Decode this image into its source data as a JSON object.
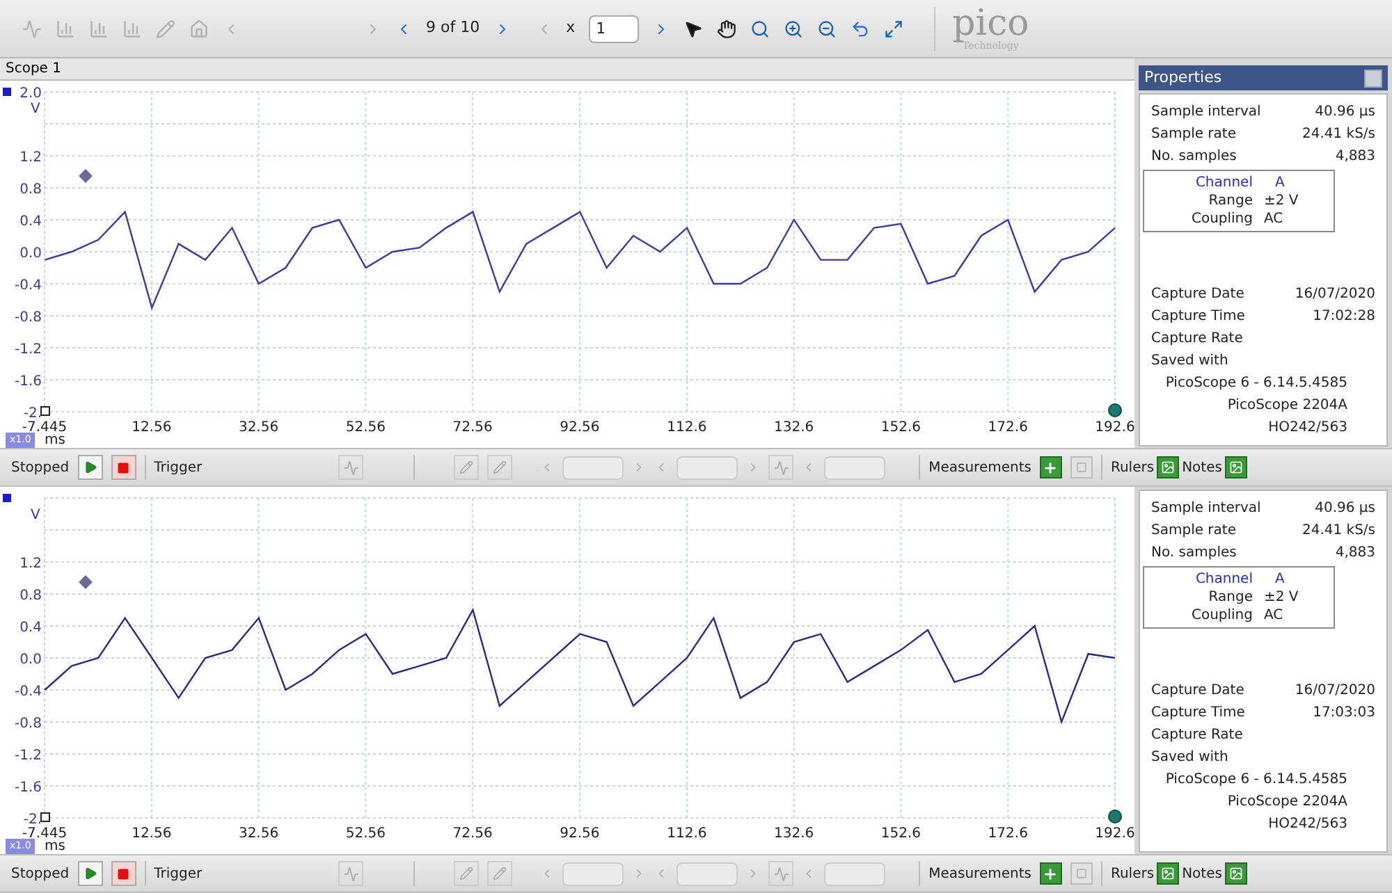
{
  "toolbar": {
    "page": "9 of 10",
    "zoom_prefix": "x",
    "zoom_value": "1",
    "logo": "pico",
    "logo_sub": "Technology"
  },
  "tab": "Scope 1",
  "scopes": [
    {
      "unit": "V",
      "time_unit": "ms",
      "zoom_badge": "x1.0",
      "chart_data": {
        "type": "line",
        "xlim": [
          -7.445,
          192.6
        ],
        "ylim": [
          -2,
          2
        ],
        "xticks": [
          {
            "value": -7.445,
            "label": "-7.445"
          },
          {
            "value": 12.56,
            "label": "12.56"
          },
          {
            "value": 32.56,
            "label": "32.56"
          },
          {
            "value": 52.56,
            "label": "52.56"
          },
          {
            "value": 72.56,
            "label": "72.56"
          },
          {
            "value": 92.56,
            "label": "92.56"
          },
          {
            "value": 112.6,
            "label": "112.6"
          },
          {
            "value": 132.6,
            "label": "132.6"
          },
          {
            "value": 152.6,
            "label": "152.6"
          },
          {
            "value": 172.6,
            "label": "172.6"
          },
          {
            "value": 192.6,
            "label": "192.6"
          }
        ],
        "yticks": [
          {
            "value": 2,
            "label": "2.0"
          },
          {
            "value": 1.2,
            "label": "1.2"
          },
          {
            "value": 0.8,
            "label": "0.8"
          },
          {
            "value": 0.4,
            "label": "0.4"
          },
          {
            "value": 0,
            "label": "0.0"
          },
          {
            "value": -0.4,
            "label": "-0.4"
          },
          {
            "value": -0.8,
            "label": "-0.8"
          },
          {
            "value": -1.2,
            "label": "-1.2"
          },
          {
            "value": -1.6,
            "label": "-1.6"
          },
          {
            "value": -2,
            "label": "-2."
          }
        ],
        "x": [
          -7.4,
          -2.4,
          2.6,
          7.6,
          12.6,
          17.6,
          22.6,
          27.6,
          32.6,
          37.6,
          42.6,
          47.6,
          52.6,
          57.6,
          62.6,
          67.6,
          72.6,
          77.6,
          82.6,
          87.6,
          92.6,
          97.6,
          102.6,
          107.6,
          112.6,
          117.6,
          122.6,
          127.6,
          132.6,
          137.6,
          142.6,
          147.6,
          152.6,
          157.6,
          162.6,
          167.6,
          172.6,
          177.6,
          182.6,
          187.6,
          192.6
        ],
        "grid": true,
        "series": [
          {
            "color": "#3b3b9e",
            "values": [
              -0.1,
              0.0,
              0.15,
              0.5,
              -0.7,
              0.1,
              -0.1,
              0.3,
              -0.4,
              -0.2,
              0.3,
              0.4,
              -0.2,
              0.0,
              0.05,
              0.3,
              0.5,
              -0.5,
              0.1,
              0.3,
              0.5,
              -0.2,
              0.2,
              0.0,
              0.3,
              -0.4,
              -0.4,
              -0.2,
              0.4,
              -0.1,
              -0.1,
              0.3,
              0.35,
              -0.4,
              -0.3,
              0.2,
              0.4,
              -0.5,
              -0.1,
              0.0,
              0.3
            ]
          }
        ]
      },
      "properties": {
        "header": "Properties",
        "rows": [
          {
            "label": "Sample interval",
            "value": "40.96 µs"
          },
          {
            "label": "Sample rate",
            "value": "24.41 kS/s"
          },
          {
            "label": "No. samples",
            "value": "4,883"
          }
        ],
        "channel": {
          "label": "Channel",
          "value": "A"
        },
        "channel_rows": [
          {
            "label": "Range",
            "value": "±2 V"
          },
          {
            "label": "Coupling",
            "value": "AC"
          }
        ],
        "capture": [
          {
            "label": "Capture Date",
            "value": "16/07/2020"
          },
          {
            "label": "Capture Time",
            "value": "17:02:28"
          },
          {
            "label": "Capture Rate"
          },
          {
            "label": "Saved with"
          }
        ],
        "saved_with": [
          "PicoScope 6 - 6.14.5.4585",
          "PicoScope 2204A",
          "HO242/563"
        ]
      },
      "controls": {
        "status": "Stopped",
        "running": false,
        "trigger": "Trigger",
        "measurements": "Measurements",
        "rulers": "Rulers",
        "notes": "Notes"
      }
    },
    {
      "unit": "V",
      "time_unit": "ms",
      "zoom_badge": "x1.0",
      "chart_data": {
        "type": "line",
        "xlim": [
          -7.445,
          192.6
        ],
        "ylim": [
          -2,
          2
        ],
        "xticks": [
          {
            "value": -7.445,
            "label": "-7.445"
          },
          {
            "value": 12.56,
            "label": "12.56"
          },
          {
            "value": 32.56,
            "label": "32.56"
          },
          {
            "value": 52.56,
            "label": "52.56"
          },
          {
            "value": 72.56,
            "label": "72.56"
          },
          {
            "value": 92.56,
            "label": "92.56"
          },
          {
            "value": 112.6,
            "label": "112.6"
          },
          {
            "value": 132.6,
            "label": "132.6"
          },
          {
            "value": 152.6,
            "label": "152.6"
          },
          {
            "value": 172.6,
            "label": "172.6"
          },
          {
            "value": 192.6,
            "label": "192.6"
          }
        ],
        "yticks": [
          {
            "value": 1.2,
            "label": "1.2"
          },
          {
            "value": 0.8,
            "label": "0.8"
          },
          {
            "value": 0.4,
            "label": "0.4"
          },
          {
            "value": 0,
            "label": "0.0"
          },
          {
            "value": -0.4,
            "label": "-0.4"
          },
          {
            "value": -0.8,
            "label": "-0.8"
          },
          {
            "value": -1.2,
            "label": "-1.2"
          },
          {
            "value": -1.6,
            "label": "-1.6"
          },
          {
            "value": -2,
            "label": "-2."
          }
        ],
        "x": [
          -7.4,
          -2.4,
          2.6,
          7.6,
          12.6,
          17.6,
          22.6,
          27.6,
          32.6,
          37.6,
          42.6,
          47.6,
          52.6,
          57.6,
          62.6,
          67.6,
          72.6,
          77.6,
          82.6,
          87.6,
          92.6,
          97.6,
          102.6,
          107.6,
          112.6,
          117.6,
          122.6,
          127.6,
          132.6,
          137.6,
          142.6,
          147.6,
          152.6,
          157.6,
          162.6,
          167.6,
          172.6,
          177.6,
          182.6,
          187.6,
          192.6
        ],
        "grid": true,
        "series": [
          {
            "color": "#2b2b80",
            "values": [
              -0.4,
              -0.1,
              0.0,
              0.5,
              0.0,
              -0.5,
              0.0,
              0.1,
              0.5,
              -0.4,
              -0.2,
              0.1,
              0.3,
              -0.2,
              -0.1,
              0.0,
              0.6,
              -0.6,
              -0.3,
              0.0,
              0.3,
              0.2,
              -0.6,
              -0.3,
              0.0,
              0.5,
              -0.5,
              -0.3,
              0.2,
              0.3,
              -0.3,
              -0.1,
              0.1,
              0.35,
              -0.3,
              -0.2,
              0.1,
              0.4,
              -0.8,
              0.05,
              0.0
            ]
          }
        ]
      },
      "properties": {
        "rows": [
          {
            "label": "Sample interval",
            "value": "40.96 µs"
          },
          {
            "label": "Sample rate",
            "value": "24.41 kS/s"
          },
          {
            "label": "No. samples",
            "value": "4,883"
          }
        ],
        "channel": {
          "label": "Channel",
          "value": "A"
        },
        "channel_rows": [
          {
            "label": "Range",
            "value": "±2 V"
          },
          {
            "label": "Coupling",
            "value": "AC"
          }
        ],
        "capture": [
          {
            "label": "Capture Date",
            "value": "16/07/2020"
          },
          {
            "label": "Capture Time",
            "value": "17:03:03"
          },
          {
            "label": "Capture Rate"
          },
          {
            "label": "Saved with"
          }
        ],
        "saved_with": [
          "PicoScope 6 - 6.14.5.4585",
          "PicoScope 2204A",
          "HO242/563"
        ]
      },
      "controls": {
        "status": "Stopped",
        "running": false,
        "trigger": "Trigger",
        "measurements": "Measurements",
        "rulers": "Rulers",
        "notes": "Notes"
      }
    }
  ]
}
